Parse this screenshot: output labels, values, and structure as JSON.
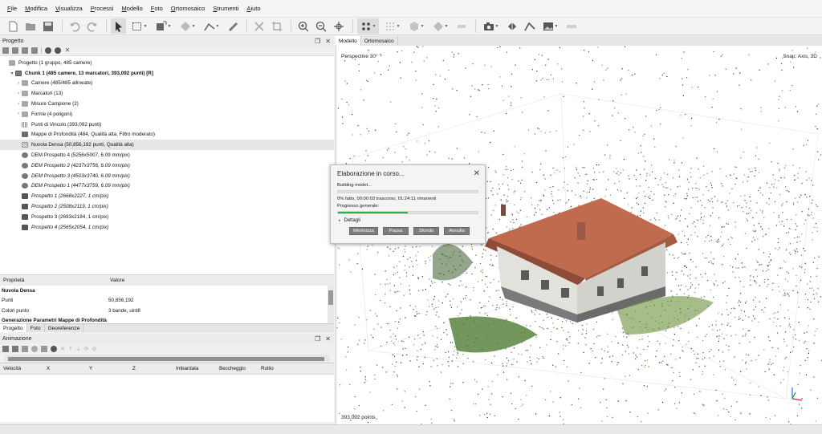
{
  "menu": [
    "File",
    "Modifica",
    "Visualizza",
    "Processi",
    "Modello",
    "Foto",
    "Ortomosaico",
    "Strumenti",
    "Aiuto"
  ],
  "project_panel": {
    "title": "Progetto",
    "tree": [
      {
        "label": "Progetto (1 gruppo, 485 camere)",
        "style": "normal",
        "indent": 0,
        "icon": "project-icon"
      },
      {
        "label": "Chunk 1 (485 camere, 13 marcatori, 393,092 punti) [R]",
        "style": "bold",
        "indent": 1,
        "icon": "chunk-icon"
      },
      {
        "label": "Camere (485/485 allineate)",
        "style": "normal",
        "indent": 2,
        "icon": "folder-icon"
      },
      {
        "label": "Marcatori (13)",
        "style": "normal",
        "indent": 2,
        "icon": "folder-icon"
      },
      {
        "label": "Misure Campione (2)",
        "style": "normal",
        "indent": 2,
        "icon": "folder-icon"
      },
      {
        "label": "Forme (4 poligoni)",
        "style": "normal",
        "indent": 2,
        "icon": "folder-icon"
      },
      {
        "label": "Punti di Vincolo (393,092 punti)",
        "style": "normal",
        "indent": 2,
        "icon": "tie-points-icon"
      },
      {
        "label": "Mappe di Profondità (484, Qualità alta, Filtro moderato)",
        "style": "normal",
        "indent": 2,
        "icon": "depth-maps-icon"
      },
      {
        "label": "Nuvola Densa (50,856,192 punti, Qualità alta)",
        "style": "normal",
        "indent": 2,
        "icon": "dense-cloud-icon",
        "selected": true
      },
      {
        "label": "DEM Prospetto 4 (5256x5007, 6.09 mm/pix)",
        "style": "normal",
        "indent": 2,
        "icon": "dem-icon"
      },
      {
        "label": "DEM Prospetto 2 (4237x3756, 6.09 mm/pix)",
        "style": "italic",
        "indent": 2,
        "icon": "dem-icon"
      },
      {
        "label": "DEM Prospetto 3 (4503x3740, 6.09 mm/pix)",
        "style": "italic",
        "indent": 2,
        "icon": "dem-icon"
      },
      {
        "label": "DEM Prospetto 1 (4477x3759, 6.09 mm/pix)",
        "style": "italic",
        "indent": 2,
        "icon": "dem-icon"
      },
      {
        "label": "Prospetto 1 (2668x2227, 1 cm/pix)",
        "style": "italic",
        "indent": 2,
        "icon": "orthomosaic-icon"
      },
      {
        "label": "Prospetto 2 (2508x2119, 1 cm/pix)",
        "style": "italic",
        "indent": 2,
        "icon": "orthomosaic-icon"
      },
      {
        "label": "Prospetto 3 (2693x2184, 1 cm/pix)",
        "style": "normal",
        "indent": 2,
        "icon": "orthomosaic-icon"
      },
      {
        "label": "Prospetto 4 (2565x2054, 1 cm/pix)",
        "style": "italic",
        "indent": 2,
        "icon": "orthomosaic-icon"
      }
    ]
  },
  "properties": {
    "col_property": "Proprietà",
    "col_value": "Valore",
    "rows": [
      {
        "key": "Nuvola Densa",
        "value": "",
        "section": true
      },
      {
        "key": "Punti",
        "value": "50,856,192",
        "section": false
      },
      {
        "key": "Colori punto",
        "value": "3 bande, uint8",
        "section": false
      },
      {
        "key": "Generazione Parametri Mappe di Profondità",
        "value": "",
        "section": true
      }
    ]
  },
  "bottom_tabs": [
    "Progetto",
    "Foto",
    "Georeferenze"
  ],
  "animation_panel": {
    "title": "Animazione",
    "columns": [
      "Velocità",
      "X",
      "Y",
      "Z",
      "Imbardata",
      "Beccheggio",
      "Rollio"
    ]
  },
  "view_tabs": [
    "Modello",
    "Ortomosaico"
  ],
  "viewport": {
    "perspective": "Perspective 30°",
    "snap": "Snap: Axis, 3D",
    "points": "393,092 points"
  },
  "dialog": {
    "title": "Elaborazione in corso...",
    "status": "Building model...",
    "stage_progress": 0,
    "time_text": "0% fatto, 00:00:03 trascorso, 01:24:11 rimanenti",
    "overall_label": "Progresso generale:",
    "overall_progress": 0.5,
    "details_label": "Dettagli",
    "buttons": [
      "Minimizza",
      "Pausa",
      "Sfondo",
      "Annulla"
    ]
  }
}
